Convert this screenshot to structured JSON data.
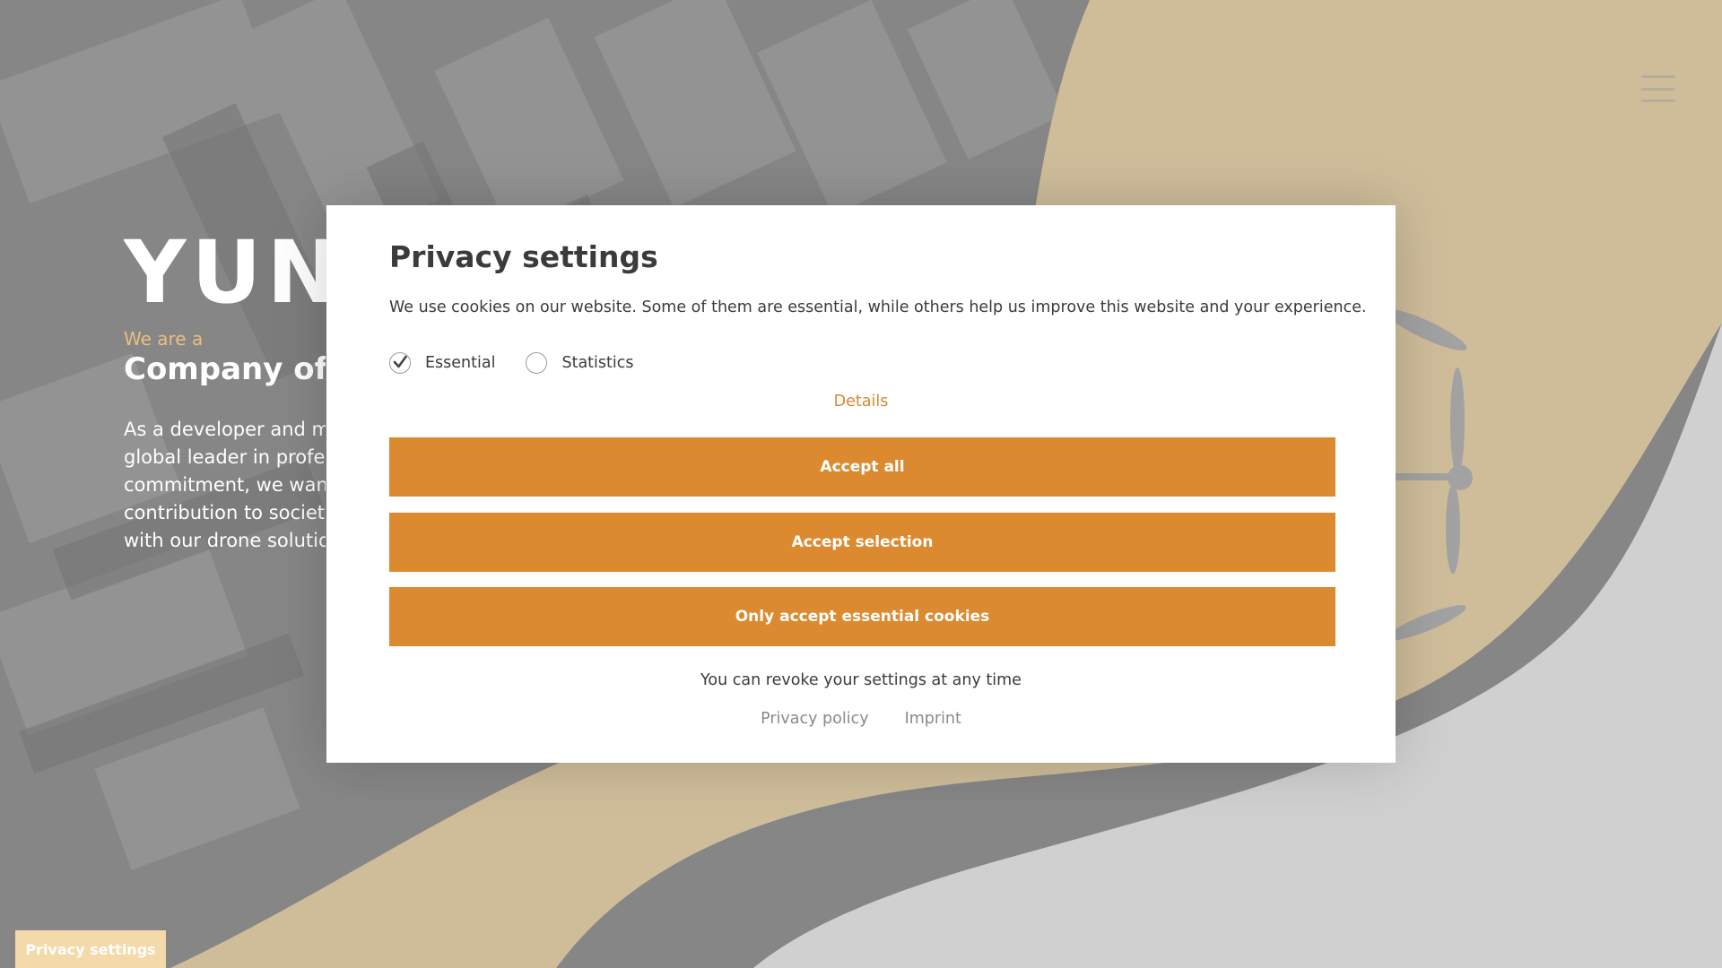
{
  "colors": {
    "accent": "#db8a30",
    "accent_link": "#d58a30",
    "wave": "#fde2ad",
    "overlay": "#787878",
    "modal_bg": "#ffffff",
    "text_dark": "#3b3b3b",
    "text_muted": "#8a8a8a"
  },
  "header": {
    "menu_icon": "hamburger-menu-icon"
  },
  "hero": {
    "logo_text": "YUNE",
    "eyebrow": "We are a",
    "title": "Company of A",
    "body_lines": [
      "As a developer and ma",
      "global leader in profes",
      "commitment, we want",
      "contribution to society",
      "with our drone solutio"
    ]
  },
  "modal": {
    "title": "Privacy settings",
    "text": "We use cookies on our website. Some of them are essential, while others help us improve this website and your experience.",
    "options": [
      {
        "label": "Essential",
        "checked": true
      },
      {
        "label": "Statistics",
        "checked": false
      }
    ],
    "details_link": "Details",
    "buttons": {
      "accept_all": "Accept all",
      "accept_selection": "Accept selection",
      "essential_only": "Only accept essential cookies"
    },
    "revoke_text": "You can revoke your settings at any time",
    "links": {
      "privacy_policy": "Privacy policy",
      "imprint": "Imprint"
    }
  },
  "privacy_tab": {
    "label": "Privacy settings"
  }
}
